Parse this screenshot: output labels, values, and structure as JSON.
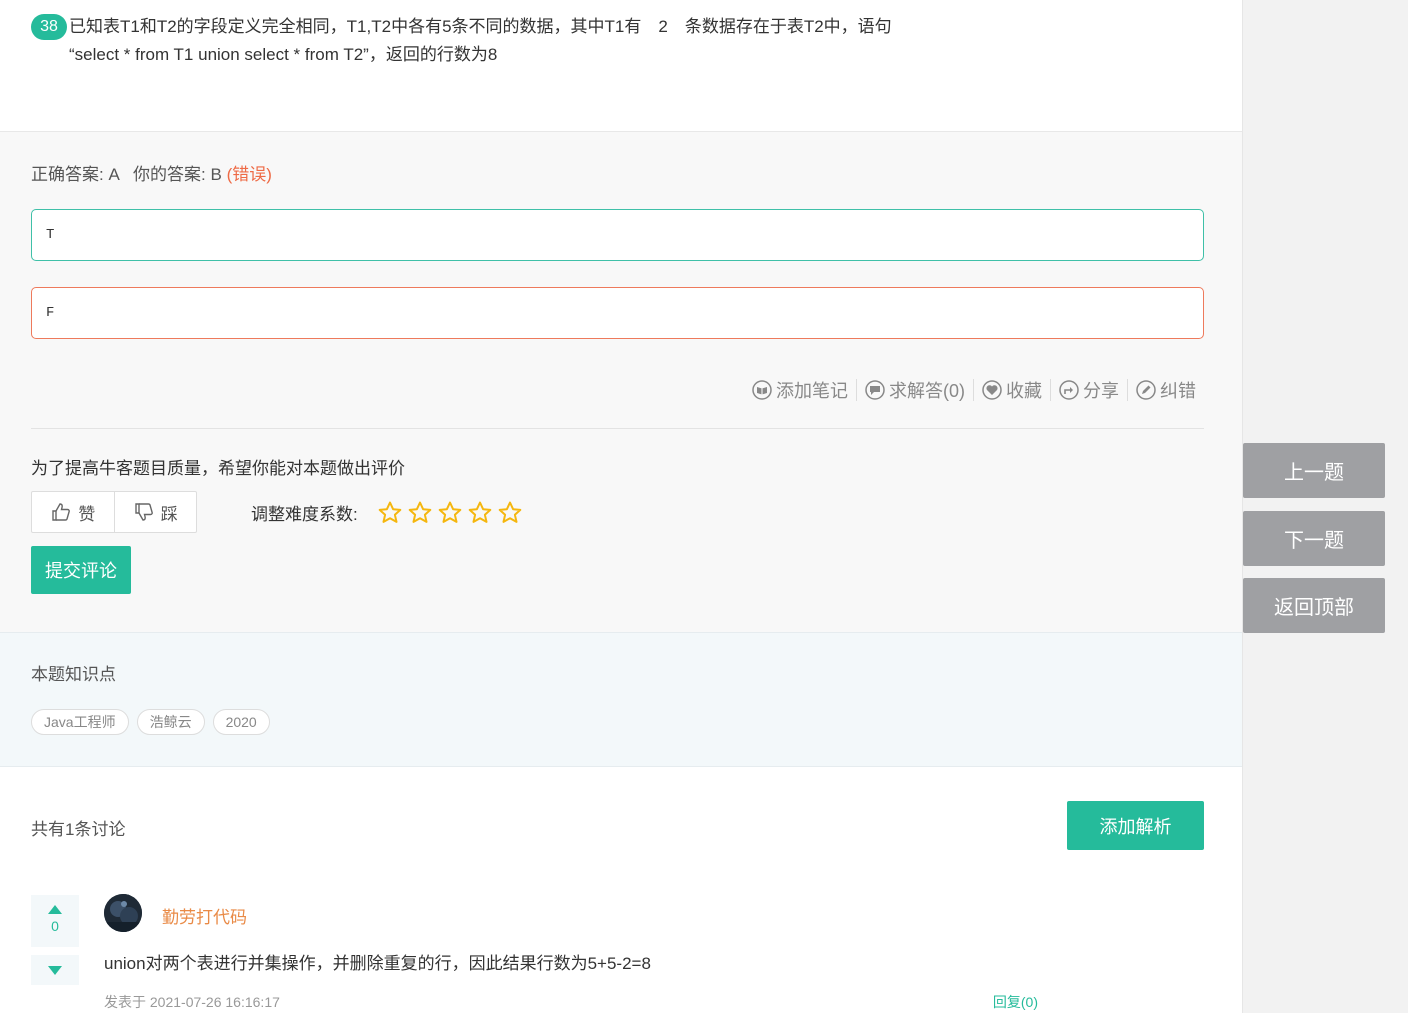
{
  "question": {
    "number": "38",
    "line1": "已知表T1和T2的字段定义完全相同，T1,T2中各有5条不同的数据，其中T1有　2　条数据存在于表T2中，语句",
    "line2": "“select * from T1 union select * from T2”，返回的行数为8"
  },
  "answer": {
    "correct_label": "正确答案: A",
    "yours_label": "你的答案: B",
    "status": "(错误)"
  },
  "options": [
    {
      "text": "T",
      "state": "correct",
      "color": "#3fc0a8"
    },
    {
      "text": "F",
      "state": "wrong",
      "color": "#ee7a5c"
    }
  ],
  "tools": [
    {
      "label": "添加笔记",
      "icon": "book-icon"
    },
    {
      "label": "求解答(0)",
      "icon": "chat-bubble-icon"
    },
    {
      "label": "收藏",
      "icon": "heart-icon"
    },
    {
      "label": "分享",
      "icon": "share-icon"
    },
    {
      "label": "纠错",
      "icon": "pencil-icon"
    }
  ],
  "rating": {
    "title": "为了提高牛客题目质量，希望你能对本题做出评价",
    "like_label": "赞",
    "dislike_label": "踩",
    "difficulty_label": "调整难度系数:",
    "stars_total": 5,
    "stars_filled": 0,
    "submit_label": "提交评论"
  },
  "knowledge": {
    "title": "本题知识点",
    "tags": [
      "Java工程师",
      "浩鲸云",
      "2020"
    ]
  },
  "discussion": {
    "count_label": "共有1条讨论",
    "add_label": "添加解析",
    "items": [
      {
        "username": "勤劳打代码",
        "votes": "0",
        "content": "union对两个表进行并集操作，并删除重复的行，因此结果行数为5+5-2=8",
        "time": "发表于 2021-07-26 16:16:17",
        "reply": "回复(0)"
      }
    ]
  },
  "nav": {
    "prev": "上一题",
    "next": "下一题",
    "top": "返回顶部"
  },
  "colors": {
    "accent": "#25bb9b",
    "wrong": "#ee6a45",
    "username": "#e98a46",
    "nav_button": "#9fa0a3",
    "star": "#f5b70f"
  }
}
